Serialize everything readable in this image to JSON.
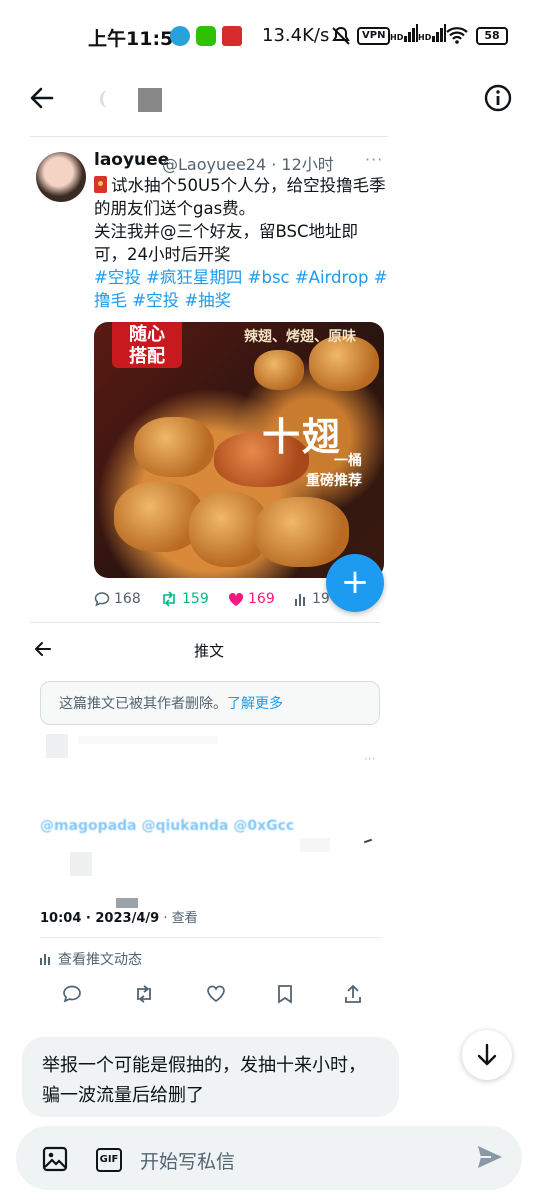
{
  "status_bar": {
    "time": "上午11:58",
    "speed": "13.4K/s",
    "network_a": "HD",
    "network_b": "HD",
    "vpn": "VPN",
    "battery": "58"
  },
  "tweet": {
    "name": "laoyuee",
    "handle": "@Laoyuee24 · 12小时",
    "more": "···",
    "text_line1": "试水抽个50U5个人分，给空投撸毛季的朋友们送个gas费。",
    "text_line2": "关注我并@三个好友，留BSC地址即可，24小时后开奖",
    "hashtags": "#空投 #疯狂星期四 #bsc #Airdrop #撸毛 #空投 #抽奖",
    "image": {
      "badge": "随心\n搭配",
      "flavor": "辣翅、烤翅、原味",
      "headline": "十翅",
      "sub1": "一桶",
      "sub2": "重磅推荐"
    },
    "stats": {
      "replies": "168",
      "retweets": "159",
      "likes": "169",
      "views": "19"
    }
  },
  "section2": {
    "title": "推文",
    "deleted_notice": "这篇推文已被其作者删除。",
    "learn_more": "了解更多",
    "more": "···",
    "mentions": "@magopada @qiukanda @0xGcc",
    "time": "10:04",
    "date": "2023/4/9",
    "views_label": "· 查看",
    "activity": "查看推文动态"
  },
  "message": {
    "text": "举报一个可能是假抽的，发抽十来小时，骗一波流量后给删了"
  },
  "composer": {
    "gif_label": "GIF",
    "placeholder": "开始写私信"
  },
  "colors": {
    "accent": "#1d9bf0",
    "retweet": "#00ba7c",
    "like": "#f91880"
  }
}
